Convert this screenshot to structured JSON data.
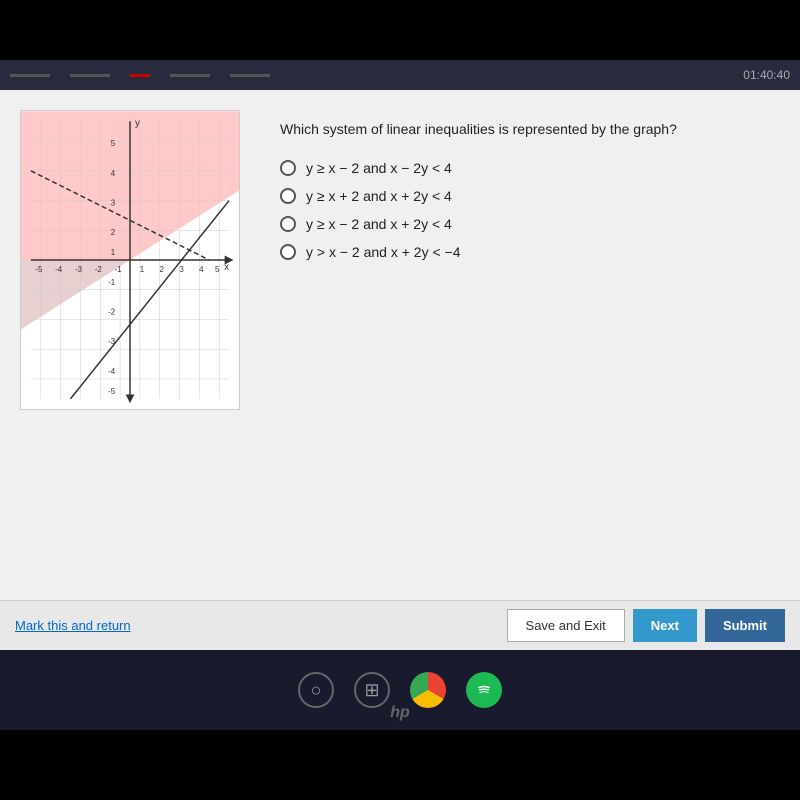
{
  "timer": "01:40:40",
  "question": {
    "text": "Which system of linear inequalities is represented by the graph?",
    "options": [
      {
        "id": "A",
        "label": "y ≥ x − 2 and x − 2y < 4"
      },
      {
        "id": "B",
        "label": "y ≥ x + 2 and x + 2y < 4"
      },
      {
        "id": "C",
        "label": "y ≥ x − 2 and x + 2y < 4"
      },
      {
        "id": "D",
        "label": "y > x − 2 and x + 2y < −4"
      }
    ]
  },
  "buttons": {
    "mark_return": "Mark this and return",
    "save_exit": "Save and Exit",
    "next": "Next",
    "submit": "Submit"
  },
  "taskbar": {
    "icons": [
      "search",
      "grid",
      "chrome",
      "spotify"
    ]
  }
}
